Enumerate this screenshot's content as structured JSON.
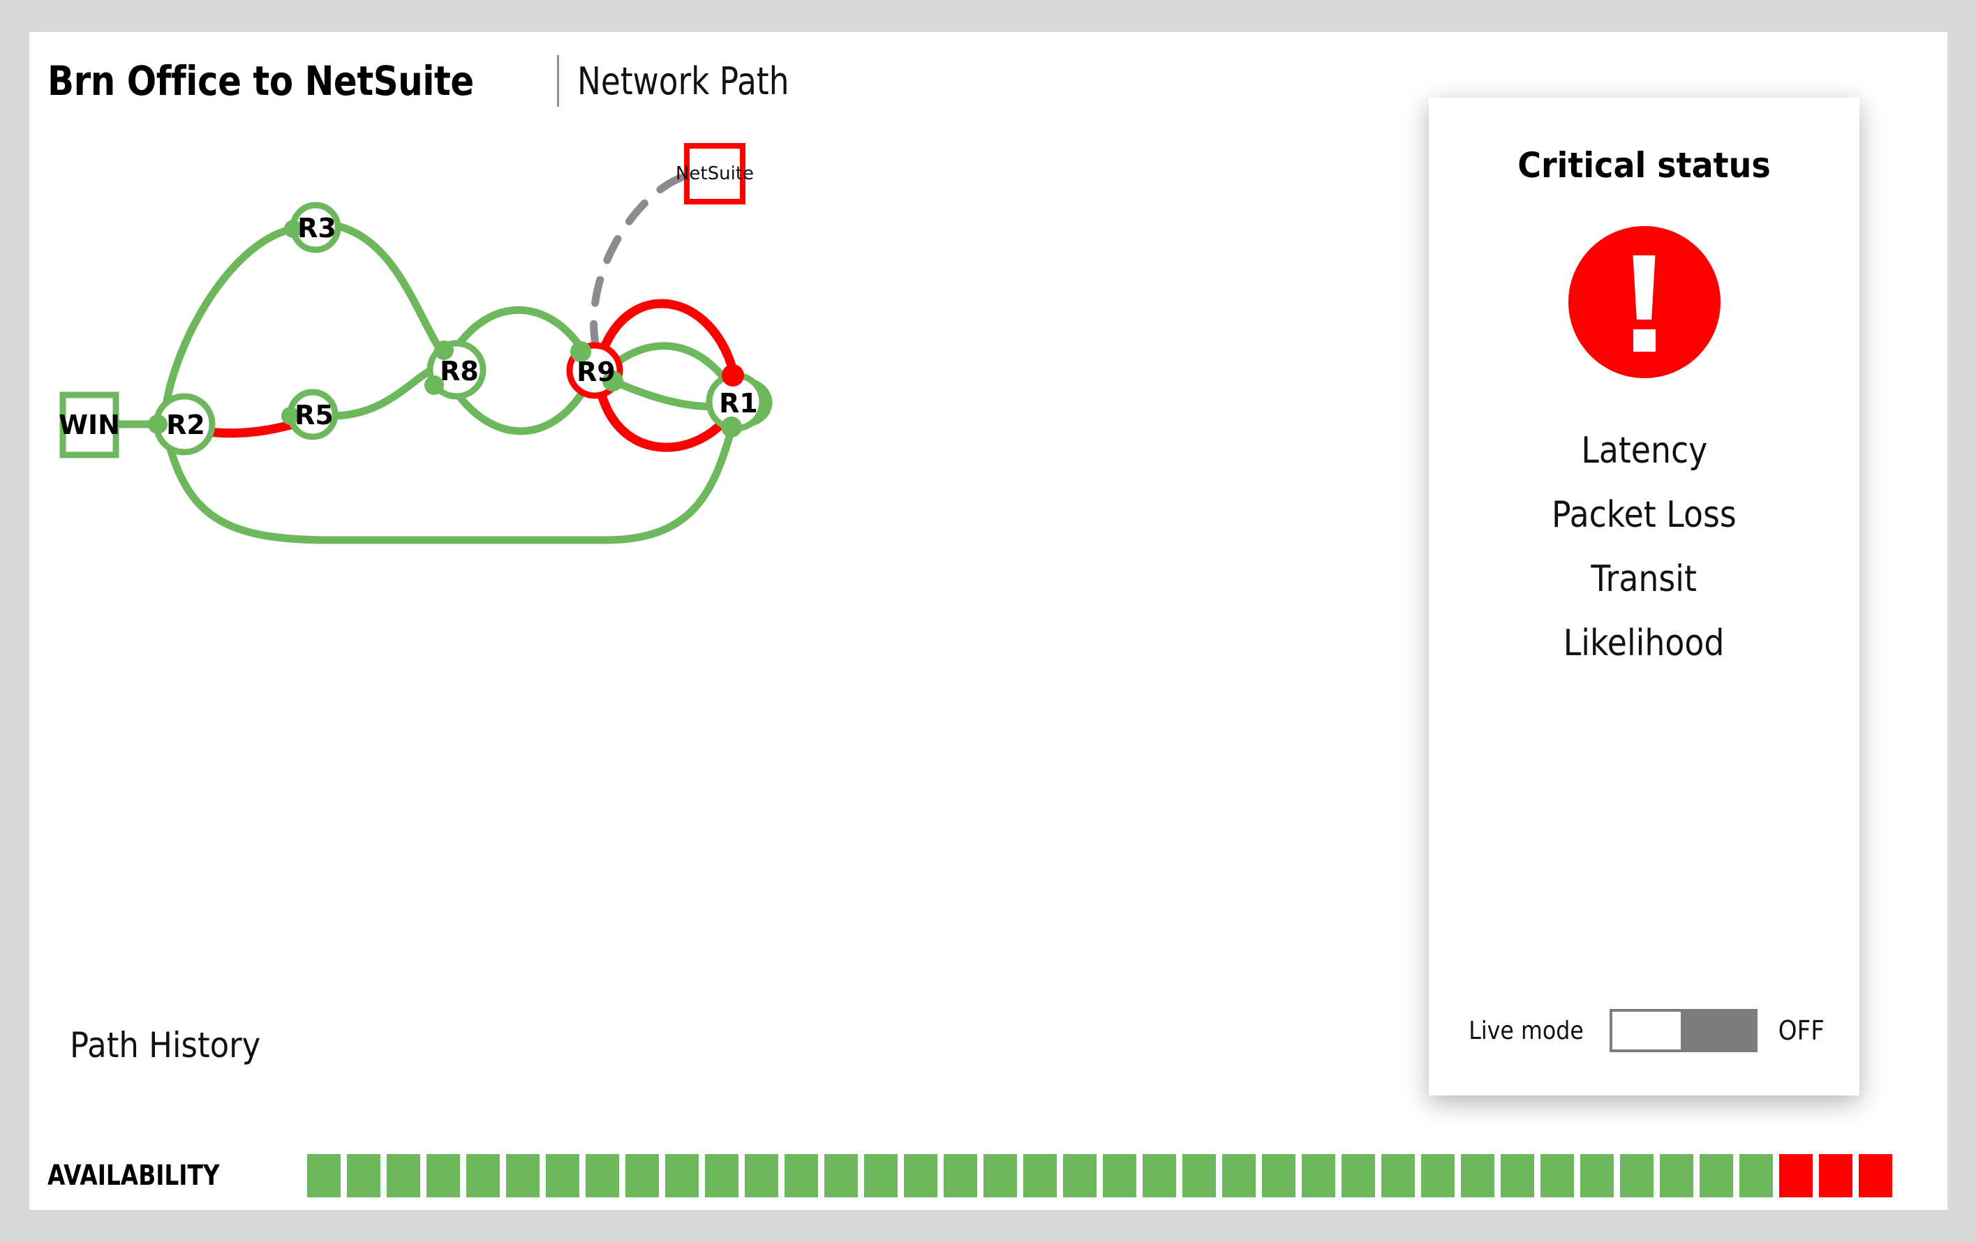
{
  "header": {
    "title_main": "Brn Office to NetSuite",
    "title_sub": "Network Path"
  },
  "graph": {
    "source_endpoint": "WIN",
    "target_endpoint": "NetSuite",
    "nodes": [
      {
        "id": "R3",
        "label": "R3",
        "status": "ok"
      },
      {
        "id": "R2",
        "label": "R2",
        "status": "ok"
      },
      {
        "id": "R5",
        "label": "R5",
        "status": "ok"
      },
      {
        "id": "R8",
        "label": "R8",
        "status": "ok"
      },
      {
        "id": "R9",
        "label": "R9",
        "status": "critical"
      },
      {
        "id": "R1",
        "label": "R1",
        "status": "ok"
      }
    ]
  },
  "path_history": {
    "label": "Path History"
  },
  "availability": {
    "label": "AVAILABILITY",
    "segments": [
      "ok",
      "ok",
      "ok",
      "ok",
      "ok",
      "ok",
      "ok",
      "ok",
      "ok",
      "ok",
      "ok",
      "ok",
      "ok",
      "ok",
      "ok",
      "ok",
      "ok",
      "ok",
      "ok",
      "ok",
      "ok",
      "ok",
      "ok",
      "ok",
      "ok",
      "ok",
      "ok",
      "ok",
      "ok",
      "ok",
      "ok",
      "ok",
      "ok",
      "ok",
      "ok",
      "ok",
      "ok",
      "bad",
      "bad",
      "bad"
    ]
  },
  "status_panel": {
    "title": "Critical status",
    "icon": "exclamation-icon",
    "metrics": [
      "Latency",
      "Packet Loss",
      "Transit",
      "Likelihood"
    ],
    "live_mode": {
      "label": "Live mode",
      "state": "OFF",
      "on": false
    }
  },
  "colors": {
    "ok": "#6db75c",
    "critical": "#ff0000",
    "inactive": "#8c8c8c",
    "page_background": "#d9d9d9",
    "card_background": "#ffffff"
  }
}
